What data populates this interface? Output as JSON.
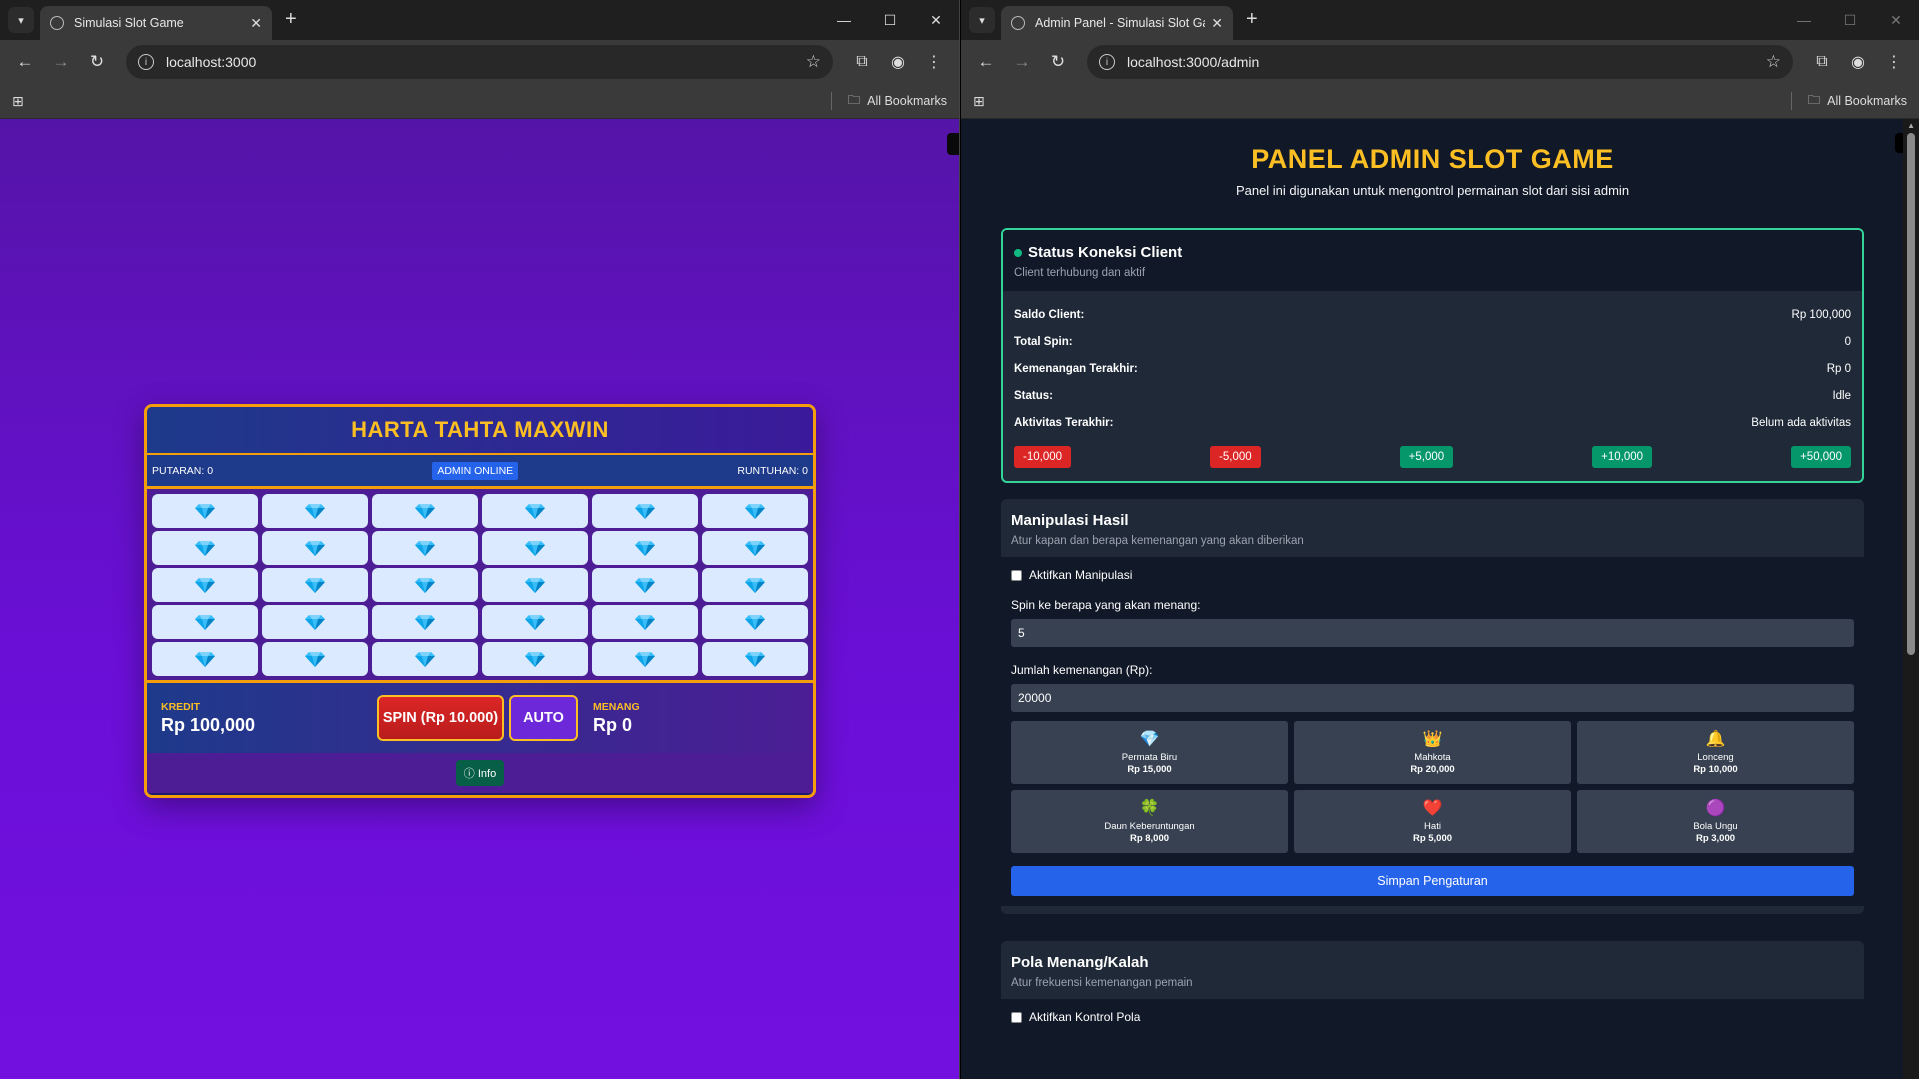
{
  "left_browser": {
    "tab_title": "Simulasi Slot Game",
    "url": "localhost:3000",
    "bookmarks_label": "All Bookmarks"
  },
  "right_browser": {
    "tab_title": "Admin Panel - Simulasi Slot Ga",
    "url": "localhost:3000/admin",
    "bookmarks_label": "All Bookmarks"
  },
  "slot_game": {
    "title": "HARTA TAHTA MAXWIN",
    "spins_label": "PUTARAN: 0",
    "admin_badge": "ADMIN ONLINE",
    "cascades_label": "RUNTUHAN: 0",
    "reel_rows": 5,
    "reel_cols": 6,
    "reel_symbol": "blue-diamond",
    "credit_label": "KREDIT",
    "credit_value": "Rp 100,000",
    "spin_button": "SPIN (Rp 10.000)",
    "auto_button": "AUTO",
    "win_label": "MENANG",
    "win_value": "Rp 0",
    "info_button": "Info"
  },
  "admin": {
    "title": "PANEL ADMIN SLOT GAME",
    "subtitle": "Panel ini digunakan untuk mengontrol permainan slot dari sisi admin",
    "status": {
      "title": "Status Koneksi Client",
      "desc": "Client terhubung dan aktif",
      "rows": [
        {
          "k": "Saldo Client:",
          "v": "Rp 100,000"
        },
        {
          "k": "Total Spin:",
          "v": "0"
        },
        {
          "k": "Kemenangan Terakhir:",
          "v": "Rp 0"
        },
        {
          "k": "Status:",
          "v": "Idle"
        },
        {
          "k": "Aktivitas Terakhir:",
          "v": "Belum ada aktivitas"
        }
      ],
      "adjust_buttons": [
        {
          "label": "-10,000",
          "kind": "neg"
        },
        {
          "label": "-5,000",
          "kind": "neg"
        },
        {
          "label": "+5,000",
          "kind": "pos"
        },
        {
          "label": "+10,000",
          "kind": "pos"
        },
        {
          "label": "+50,000",
          "kind": "pos"
        }
      ]
    },
    "manipulation": {
      "title": "Manipulasi Hasil",
      "desc": "Atur kapan dan berapa kemenangan yang akan diberikan",
      "enable_label": "Aktifkan Manipulasi",
      "spin_label": "Spin ke berapa yang akan menang:",
      "spin_value": "5",
      "amount_label": "Jumlah kemenangan (Rp):",
      "amount_value": "20000",
      "symbols": [
        {
          "icon": "💎",
          "name": "Permata Biru",
          "value": "Rp 15,000"
        },
        {
          "icon": "👑",
          "name": "Mahkota",
          "value": "Rp 20,000"
        },
        {
          "icon": "🔔",
          "name": "Lonceng",
          "value": "Rp 10,000"
        },
        {
          "icon": "🍀",
          "name": "Daun Keberuntungan",
          "value": "Rp 8,000"
        },
        {
          "icon": "❤️",
          "name": "Hati",
          "value": "Rp 5,000"
        },
        {
          "icon": "🟣",
          "name": "Bola Ungu",
          "value": "Rp 3,000"
        }
      ],
      "save_button": "Simpan Pengaturan"
    },
    "pattern": {
      "title": "Pola Menang/Kalah",
      "desc": "Atur frekuensi kemenangan pemain",
      "enable_label": "Aktifkan Kontrol Pola"
    }
  },
  "colors": {
    "gold": "#fbbf24",
    "admin_bg": "#111827",
    "status_border": "#34d399",
    "game_purple": "#6a0fd6"
  }
}
